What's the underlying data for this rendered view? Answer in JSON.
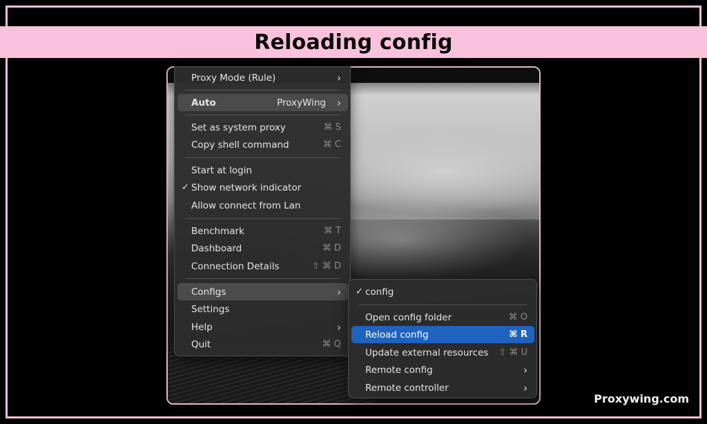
{
  "banner": {
    "title": "Reloading config"
  },
  "watermark": "Proxywing.com",
  "main_menu": {
    "proxy_mode": "Proxy Mode (Rule)",
    "auto": {
      "label": "Auto",
      "value": "ProxyWing"
    },
    "set_system_proxy": {
      "label": "Set as system proxy",
      "shortcut": "⌘ S"
    },
    "copy_shell": {
      "label": "Copy shell command",
      "shortcut": "⌘ C"
    },
    "start_at_login": "Start at login",
    "show_network_indicator": {
      "label": "Show network indicator",
      "check": "✓",
      "checked": true
    },
    "allow_lan": "Allow connect from Lan",
    "benchmark": {
      "label": "Benchmark",
      "shortcut": "⌘ T"
    },
    "dashboard": {
      "label": "Dashboard",
      "shortcut": "⌘ D"
    },
    "connection_details": {
      "label": "Connection Details",
      "shortcut": "⇧ ⌘ D"
    },
    "configs": "Configs",
    "settings": "Settings",
    "help": "Help",
    "quit": {
      "label": "Quit",
      "shortcut": "⌘ Q"
    }
  },
  "sub_menu": {
    "config": {
      "label": "config",
      "check": "✓",
      "checked": true
    },
    "open_folder": {
      "label": "Open config folder",
      "shortcut": "⌘ O"
    },
    "reload": {
      "label": "Reload config",
      "shortcut": "⌘ R"
    },
    "update_resources": {
      "label": "Update external resources",
      "shortcut": "⇧ ⌘ U"
    },
    "remote_config": "Remote config",
    "remote_controller": "Remote controller"
  },
  "icons": {
    "chevron": "chevron-right-icon",
    "check": "checkmark-icon"
  },
  "colors": {
    "banner": "#f9c1dc",
    "selection": "#1f62c0",
    "menu_bg": "#2c2c2c"
  }
}
